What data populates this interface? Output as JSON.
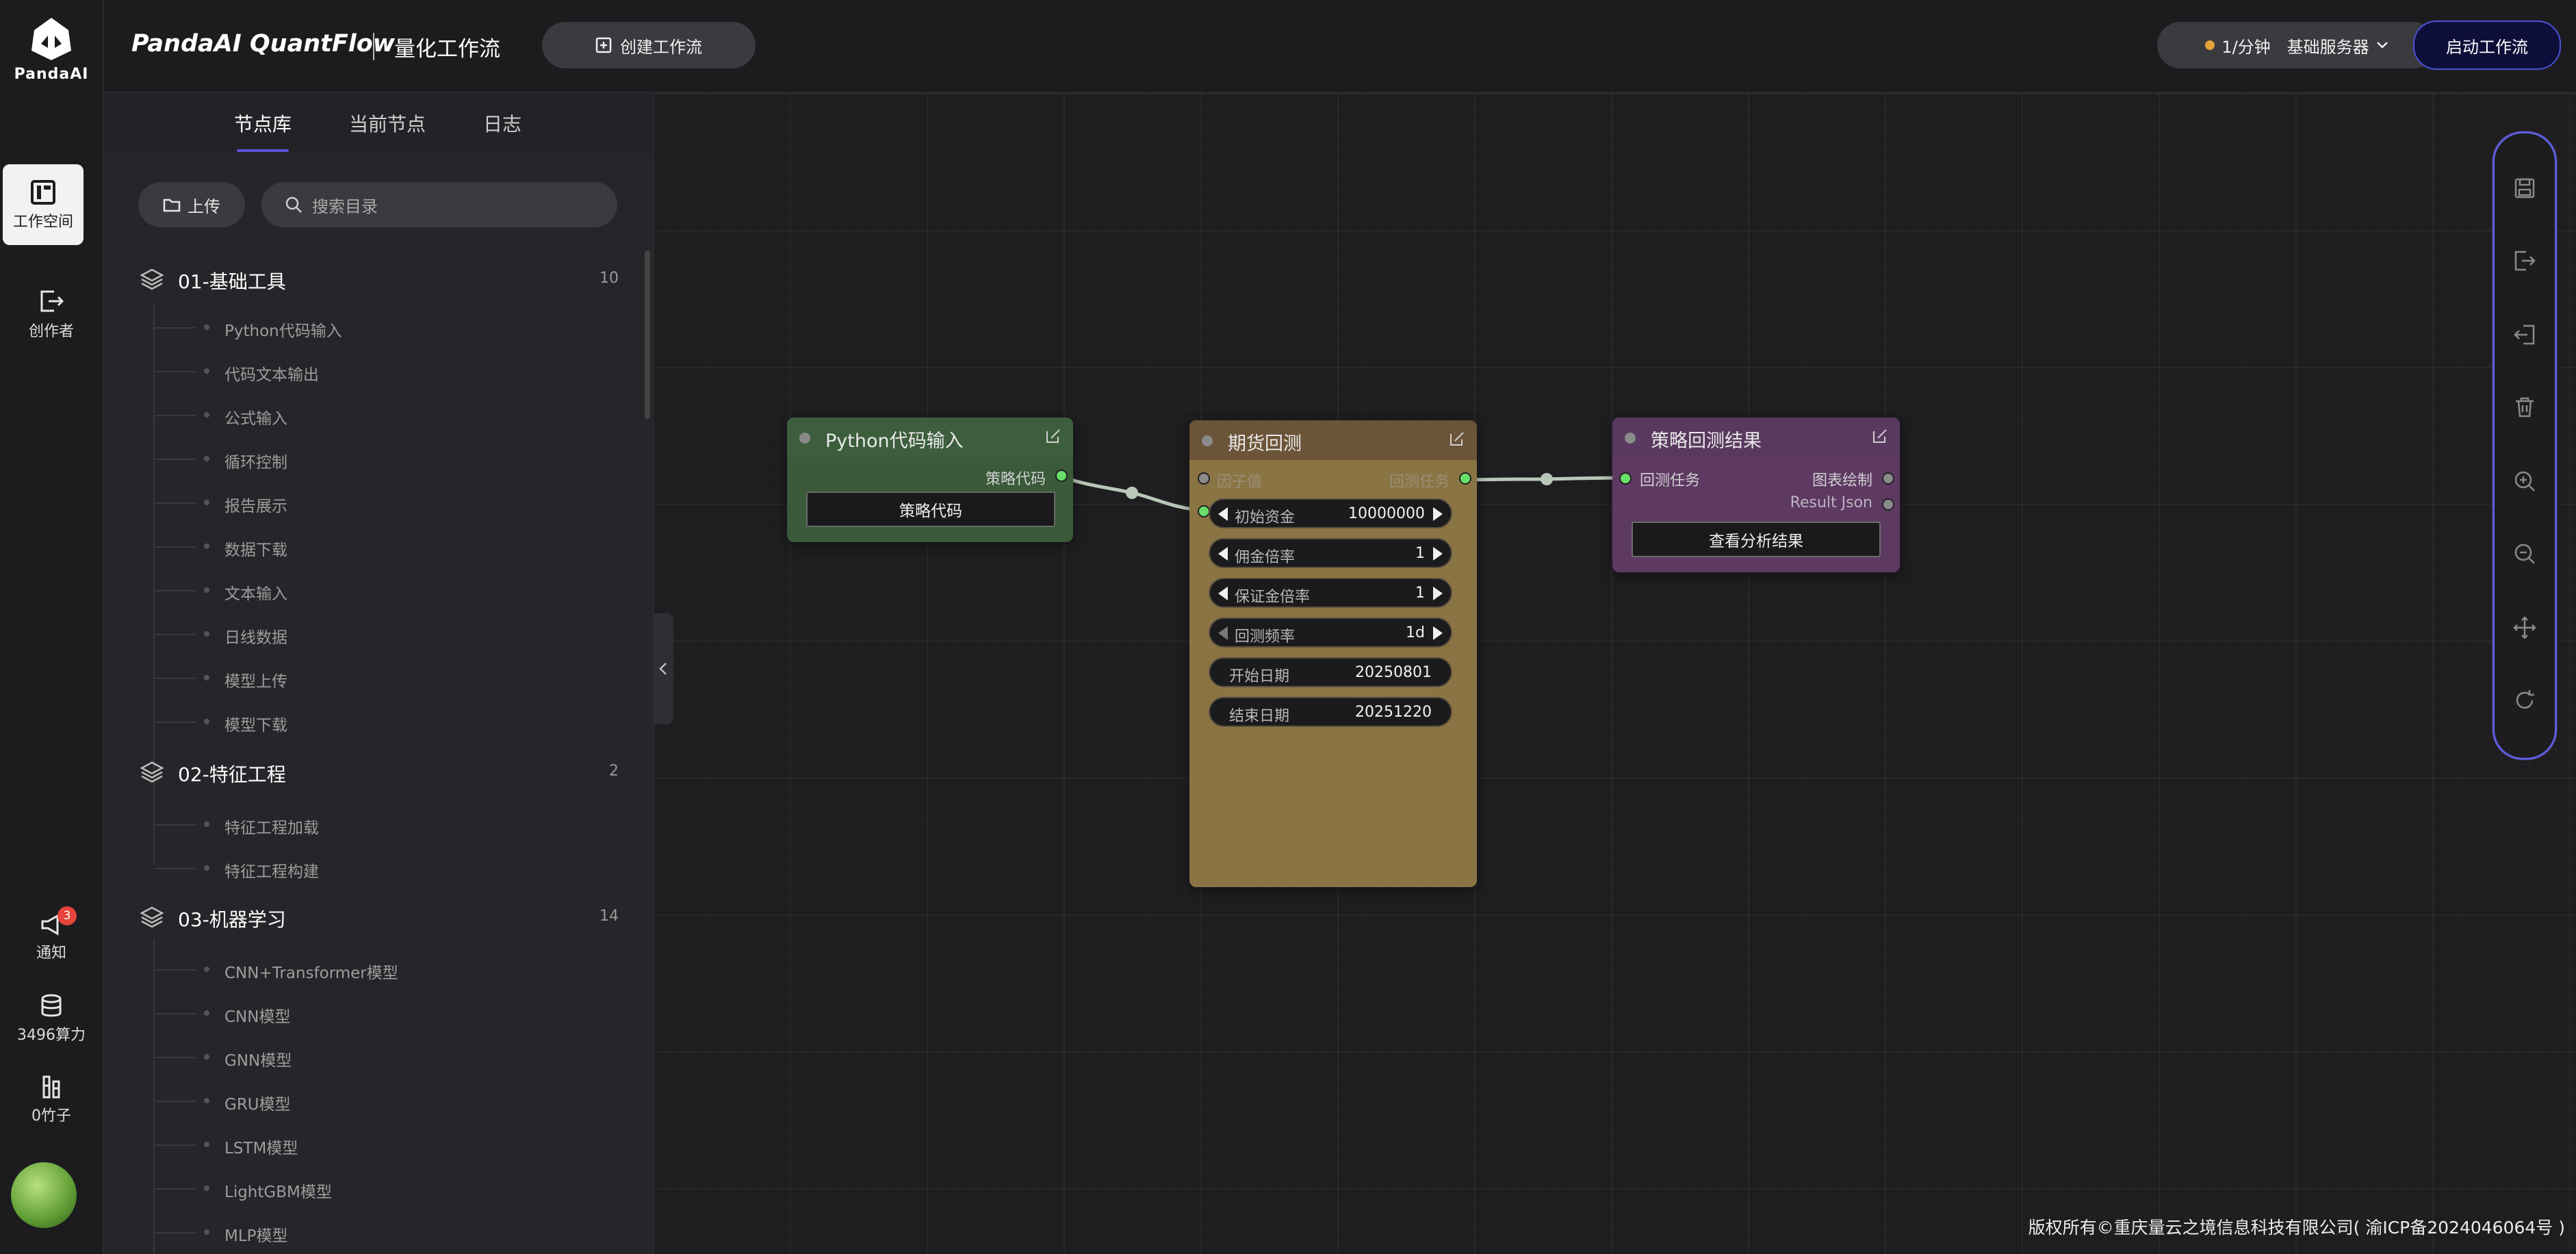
{
  "rail": {
    "logo_text": "PandaAI",
    "items": [
      {
        "label": "工作空间"
      },
      {
        "label": "创作者"
      }
    ],
    "notify": {
      "label": "通知",
      "badge": "3"
    },
    "compute": {
      "label": "3496算力"
    },
    "bamboo": {
      "label": "0竹子"
    }
  },
  "topbar": {
    "brand": "PandaAI QuantFlow",
    "subtitle": "量化工作流",
    "create_label": "创建工作流",
    "server_rate": "1/分钟",
    "server_name": "基础服务器",
    "start_label": "启动工作流"
  },
  "panel": {
    "tabs": [
      "节点库",
      "当前节点",
      "日志"
    ],
    "active_tab": "节点库",
    "upload_label": "上传",
    "search_placeholder": "搜索目录",
    "categories": [
      {
        "title": "01-基础工具",
        "count": "10",
        "items": [
          "Python代码输入",
          "代码文本输出",
          "公式输入",
          "循环控制",
          "报告展示",
          "数据下载",
          "文本输入",
          "日线数据",
          "模型上传",
          "模型下载"
        ]
      },
      {
        "title": "02-特征工程",
        "count": "2",
        "items": [
          "特征工程加载",
          "特征工程构建"
        ]
      },
      {
        "title": "03-机器学习",
        "count": "14",
        "items": [
          "CNN+Transformer模型",
          "CNN模型",
          "GNN模型",
          "GRU模型",
          "LSTM模型",
          "LightGBM模型",
          "MLP模型"
        ]
      }
    ]
  },
  "nodes": {
    "python": {
      "title": "Python代码输入",
      "output_label": "策略代码",
      "button_label": "策略代码",
      "color": "#3b5e3b"
    },
    "futures": {
      "title": "期货回测",
      "input_factor": "因子值",
      "output_task": "回测任务",
      "color": "#8b7444",
      "header_color": "#6b5438",
      "widgets": [
        {
          "label": "初始资金",
          "value": "10000000"
        },
        {
          "label": "佣金倍率",
          "value": "1"
        },
        {
          "label": "保证金倍率",
          "value": "1"
        },
        {
          "label": "回测频率",
          "value": "1d"
        },
        {
          "label": "开始日期",
          "value": "20250801"
        },
        {
          "label": "结束日期",
          "value": "20251220"
        }
      ]
    },
    "result": {
      "title": "策略回测结果",
      "input_task": "回测任务",
      "output_chart": "图表绘制",
      "output_json": "Result Json",
      "button_label": "查看分析结果",
      "color": "#5e3a63"
    }
  },
  "toolbar": {
    "icons": [
      "save-icon",
      "export-icon",
      "import-icon",
      "delete-icon",
      "zoom-in-icon",
      "zoom-out-icon",
      "fit-view-icon",
      "refresh-icon"
    ]
  },
  "footer": {
    "text": "版权所有©重庆量云之境信息科技有限公司( 渝ICP备2024046064号 )"
  }
}
